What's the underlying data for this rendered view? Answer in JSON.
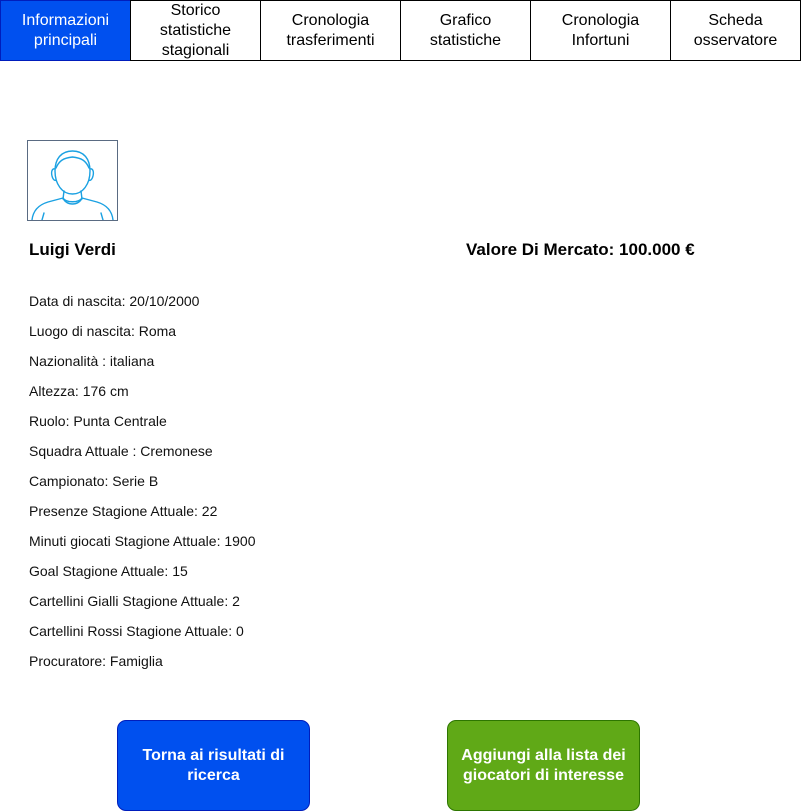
{
  "tabs": [
    {
      "label": "Informazioni\nprincipali",
      "active": true
    },
    {
      "label": "Storico statistiche\nstagionali",
      "active": false
    },
    {
      "label": "Cronologia\ntrasferimenti",
      "active": false
    },
    {
      "label": "Grafico\nstatistiche",
      "active": false
    },
    {
      "label": "Cronologia\nInfortuni",
      "active": false
    },
    {
      "label": "Scheda\nosservatore",
      "active": false
    }
  ],
  "player": {
    "avatar_icon": "user-silhouette-icon",
    "name": "Luigi Verdi",
    "market_value": "Valore Di Mercato: 100.000 €",
    "details": [
      "Data di nascita: 20/10/2000",
      "Luogo di nascita: Roma",
      "Nazionalità : italiana",
      "Altezza: 176 cm",
      "Ruolo: Punta Centrale",
      "Squadra Attuale : Cremonese",
      "Campionato: Serie B",
      "Presenze Stagione Attuale: 22",
      "Minuti giocati Stagione Attuale: 1900",
      "Goal Stagione Attuale: 15",
      "Cartellini Gialli Stagione Attuale: 2",
      "Cartellini Rossi Stagione Attuale: 0",
      "Procuratore: Famiglia"
    ]
  },
  "actions": {
    "back_label": "Torna ai risultati di ricerca",
    "add_label": "Aggiungi alla lista dei giocatori di interesse"
  },
  "colors": {
    "primary": "#0050ef",
    "success": "#60a917",
    "avatar_stroke": "#1ba1e2"
  }
}
